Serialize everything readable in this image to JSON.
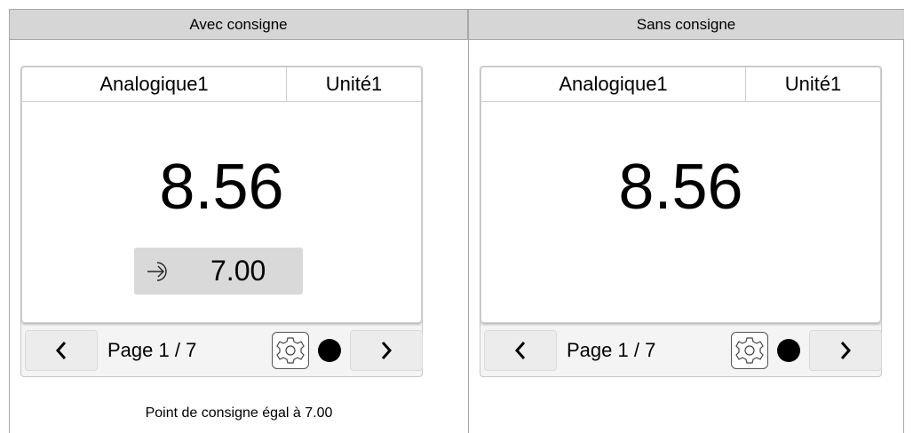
{
  "columns": {
    "left_header": "Avec consigne",
    "right_header": "Sans consigne"
  },
  "screens": [
    {
      "name": "Analogique1",
      "unit": "Unité1",
      "value": "8.56",
      "setpoint": "7.00",
      "page_label": "Page 1 / 7"
    },
    {
      "name": "Analogique1",
      "unit": "Unité1",
      "value": "8.56",
      "page_label": "Page 1 / 7"
    }
  ],
  "caption": "Point de consigne égal à 7.00",
  "icons": {
    "prev": "chevron-left-icon",
    "next": "chevron-right-icon",
    "settings": "gear-icon",
    "status": "status-dot",
    "setpoint": "setpoint-arrow-icon"
  }
}
